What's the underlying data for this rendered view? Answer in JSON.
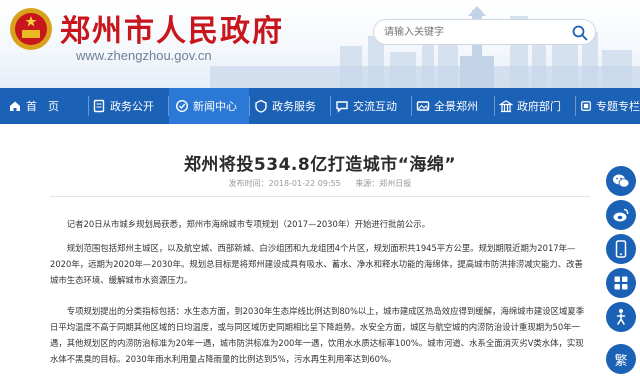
{
  "header": {
    "site_title": "郑州市人民政府",
    "site_domain": "www.zhengzhou.gov.cn",
    "search_placeholder": "请输入关键字"
  },
  "nav": {
    "items": [
      {
        "label": "首　页",
        "icon": "home-icon"
      },
      {
        "label": "政务公开",
        "icon": "document-icon"
      },
      {
        "label": "新闻中心",
        "icon": "news-icon",
        "active": true
      },
      {
        "label": "政务服务",
        "icon": "service-icon"
      },
      {
        "label": "交流互动",
        "icon": "chat-icon"
      },
      {
        "label": "全景郑州",
        "icon": "panorama-icon"
      },
      {
        "label": "政府部门",
        "icon": "building-icon"
      },
      {
        "label": "专题专栏",
        "icon": "topic-icon"
      }
    ]
  },
  "article": {
    "title": "郑州将投534.8亿打造城市“海绵”",
    "date": "发布时间：2018-01-22 09:55",
    "source": "来源：郑州日报",
    "paragraphs": [
      "记者20日从市城乡规划局获悉，郑州市海绵城市专项规划（2017—2030年）开始进行批前公示。",
      "规划范围包括郑州主城区，以及航空城、西部新城、白沙组团和九龙组团4个片区，规划面积共1945平方公里。规划期限近期为2017年—2020年，远期为2020年—2030年。规划总目标是将郑州建设成具有吸水、蓄水、净水和释水功能的海绵体，提高城市防洪排涝减灾能力、改善城市生态环境、缓解城市水资源压力。",
      "专项规划提出的分类指标包括：水生态方面，到2030年生态岸线比例达到80%以上，城市建成区热岛效应得到缓解，海绵城市建设区域夏季日平均温度不高于同期其他区域的日均温度，或与同区域历史同期相比呈下降趋势。水安全方面，城区与航空城的内涝防治设计重现期为50年一遇，其他规划区的内涝防治标准为20年一遇，城市防洪标准为200年一遇，饮用水水质达标率100%。城市河道、水系全面消灭劣V类水体，实现水体不黑臭的目标。2030年雨水利用量占降雨量的比例达到5%，污水再生利用率达到60%。"
    ]
  },
  "float_toolbar": {
    "items": [
      {
        "icon": "wechat-icon"
      },
      {
        "icon": "weibo-icon"
      },
      {
        "icon": "mobile-icon"
      },
      {
        "icon": "app-icon"
      },
      {
        "icon": "elder-mode-icon"
      },
      {
        "icon": "accessibility-icon"
      },
      {
        "icon": "traditional-chinese-icon",
        "label": "繁"
      }
    ]
  },
  "colors": {
    "brand_red": "#c8161d",
    "nav_blue": "#1b61b5",
    "nav_active": "#2b78d6"
  }
}
